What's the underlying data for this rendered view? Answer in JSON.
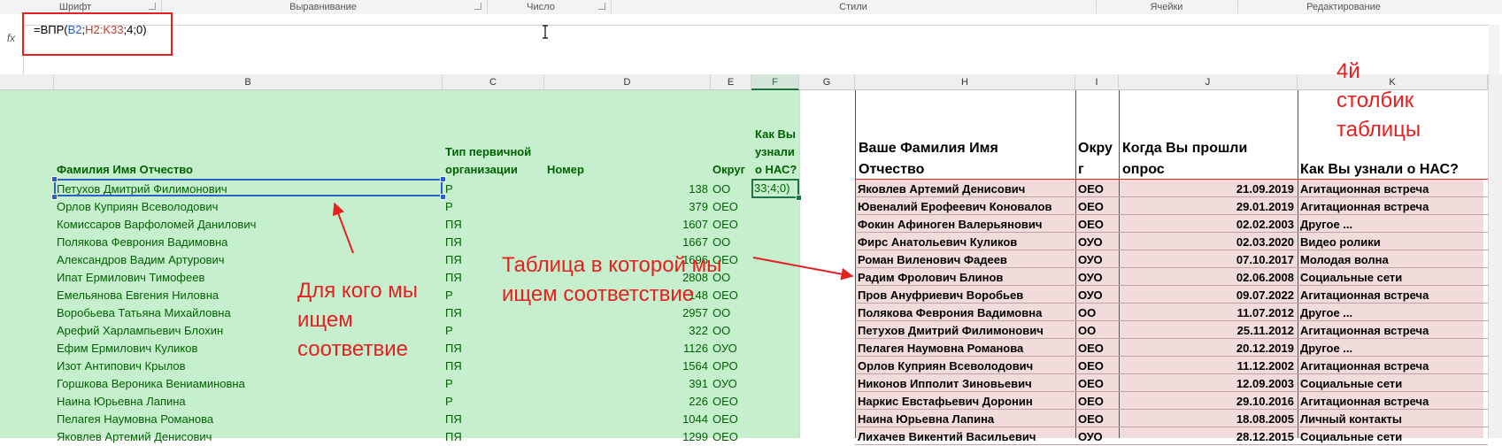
{
  "ribbon": {
    "groups": [
      "Шрифт",
      "Выравнивание",
      "Число",
      "Стили",
      "Ячейки",
      "Редактирование"
    ]
  },
  "formula_bar": {
    "fx": "fx",
    "prefix": "=ВПР(",
    "ref1": "B2",
    "sep1": ";",
    "ref2": "H2:K33",
    "suffix": ";4;0)"
  },
  "columns": [
    "B",
    "C",
    "D",
    "E",
    "F",
    "G",
    "H",
    "I",
    "J",
    "K"
  ],
  "left_table": {
    "headers": {
      "fio": "Фамилия Имя Отчество",
      "type_1": "Тип первичной",
      "type_2": "организации",
      "number": "Номер",
      "okrug": "Округ",
      "how_1": "Как Вы",
      "how_2": "узнали",
      "how_3": "о НАС?"
    },
    "active_cell_text": "33;4;0)",
    "rows": [
      {
        "fio": "Петухов Дмитрий Филимонович",
        "type": "Р",
        "num": "138",
        "okrug": "ОО"
      },
      {
        "fio": "Орлов Куприян Всеволодович",
        "type": "Р",
        "num": "379",
        "okrug": "ОЕО"
      },
      {
        "fio": "Комиссаров Варфоломей Данилович",
        "type": "ПЯ",
        "num": "1607",
        "okrug": "ОЕО"
      },
      {
        "fio": "Полякова Феврония Вадимовна",
        "type": "ПЯ",
        "num": "1667",
        "okrug": "ОО"
      },
      {
        "fio": "Александров Вадим Артурович",
        "type": "ПЯ",
        "num": "1696",
        "okrug": "ОЕО"
      },
      {
        "fio": "Ипат Ермилович Тимофеев",
        "type": "ПЯ",
        "num": "2808",
        "okrug": "ОО"
      },
      {
        "fio": "Емельянова Евгения Ниловна",
        "type": "Р",
        "num": "148",
        "okrug": "ОЕО"
      },
      {
        "fio": "Воробьева Татьяна Михайловна",
        "type": "ПЯ",
        "num": "2957",
        "okrug": "ОО"
      },
      {
        "fio": "Арефий Харлампьевич Блохин",
        "type": "Р",
        "num": "322",
        "okrug": "ОО"
      },
      {
        "fio": "Ефим Ермилович Куликов",
        "type": "ПЯ",
        "num": "1126",
        "okrug": "ОУО"
      },
      {
        "fio": "Изот Антипович Крылов",
        "type": "ПЯ",
        "num": "1564",
        "okrug": "ОРО"
      },
      {
        "fio": "Горшкова Вероника Вениаминовна",
        "type": "Р",
        "num": "391",
        "okrug": "ОУО"
      },
      {
        "fio": "Наина Юрьевна Лапина",
        "type": "Р",
        "num": "226",
        "okrug": "ОЕО"
      },
      {
        "fio": "Пелагея Наумовна Романова",
        "type": "ПЯ",
        "num": "1044",
        "okrug": "ОЕО"
      },
      {
        "fio": "Яковлев Артемий Денисович",
        "type": "ПЯ",
        "num": "1299",
        "okrug": "ОЕО"
      }
    ]
  },
  "right_table": {
    "headers": {
      "fio_1": "Ваше Фамилия Имя",
      "fio_2": "Отчество",
      "okrug_1": "Окру",
      "okrug_2": "г",
      "date_1": "Когда Вы прошли",
      "date_2": "опрос",
      "how": "Как Вы узнали о НАС?"
    },
    "rows": [
      {
        "fio": "Яковлев Артемий Денисович",
        "okrug": "ОЕО",
        "date": "21.09.2019",
        "how": "Агитационная встреча"
      },
      {
        "fio": "Ювеналий Ерофеевич Коновалов",
        "okrug": "ОЕО",
        "date": "29.01.2019",
        "how": "Агитационная встреча"
      },
      {
        "fio": "Фокин Афиноген Валерьянович",
        "okrug": "ОЕО",
        "date": "02.02.2003",
        "how": "Другое ..."
      },
      {
        "fio": "Фирс Анатольевич Куликов",
        "okrug": "ОУО",
        "date": "02.03.2020",
        "how": "Видео ролики"
      },
      {
        "fio": "Роман Виленович Фадеев",
        "okrug": "ОУО",
        "date": "07.10.2017",
        "how": "Молодая волна"
      },
      {
        "fio": "Радим Фролович Блинов",
        "okrug": "ОУО",
        "date": "02.06.2008",
        "how": "Социальные сети"
      },
      {
        "fio": "Пров Ануфриевич Воробьев",
        "okrug": "ОУО",
        "date": "09.07.2022",
        "how": "Агитационная встреча"
      },
      {
        "fio": "Полякова Феврония Вадимовна",
        "okrug": "ОО",
        "date": "11.07.2012",
        "how": "Другое ..."
      },
      {
        "fio": "Петухов Дмитрий Филимонович",
        "okrug": "ОО",
        "date": "25.11.2012",
        "how": "Агитационная встреча"
      },
      {
        "fio": "Пелагея Наумовна Романова",
        "okrug": "ОЕО",
        "date": "20.12.2019",
        "how": "Другое ..."
      },
      {
        "fio": "Орлов Куприян Всеволодович",
        "okrug": "ОЕО",
        "date": "11.12.2002",
        "how": "Агитационная встреча"
      },
      {
        "fio": "Никонов Ипполит Зиновьевич",
        "okrug": "ОЕО",
        "date": "12.09.2003",
        "how": "Социальные сети"
      },
      {
        "fio": "Наркис Евстафьевич Доронин",
        "okrug": "ОЕО",
        "date": "29.10.2016",
        "how": "Агитационная встреча"
      },
      {
        "fio": "Наина Юрьевна Лапина",
        "okrug": "ОЕО",
        "date": "18.08.2005",
        "how": "Личный контакты"
      },
      {
        "fio": "Лихачев Викентий Васильевич",
        "okrug": "ОУО",
        "date": "28.12.2015",
        "how": "Социальные сети"
      }
    ]
  },
  "annotations": {
    "for_whom": [
      "Для кого мы",
      "ищем",
      "соответвие"
    ],
    "table_where": [
      "Таблица в которой мы",
      "ищем соответствие"
    ],
    "fourth_col": [
      "4й",
      "столбик",
      "таблицы"
    ]
  },
  "colors": {
    "annotation": "#e52020",
    "green_fill": "#c6efce",
    "green_text": "#006100",
    "pink_fill": "#f2dcdb",
    "selection": "#2b61c7"
  }
}
